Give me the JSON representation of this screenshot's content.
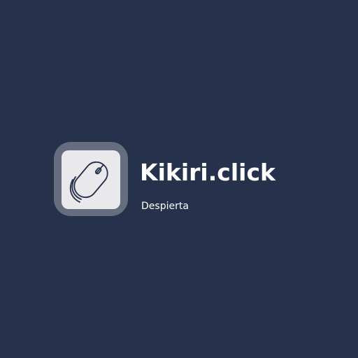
{
  "logo": {
    "icon": "computer-mouse-icon",
    "brand_name": "Kikiri.click",
    "tagline": "Despierta"
  },
  "colors": {
    "background": "#26324b",
    "icon_frame": "#666d7f",
    "icon_tile": "#e9e9ec",
    "text": "#ffffff"
  }
}
